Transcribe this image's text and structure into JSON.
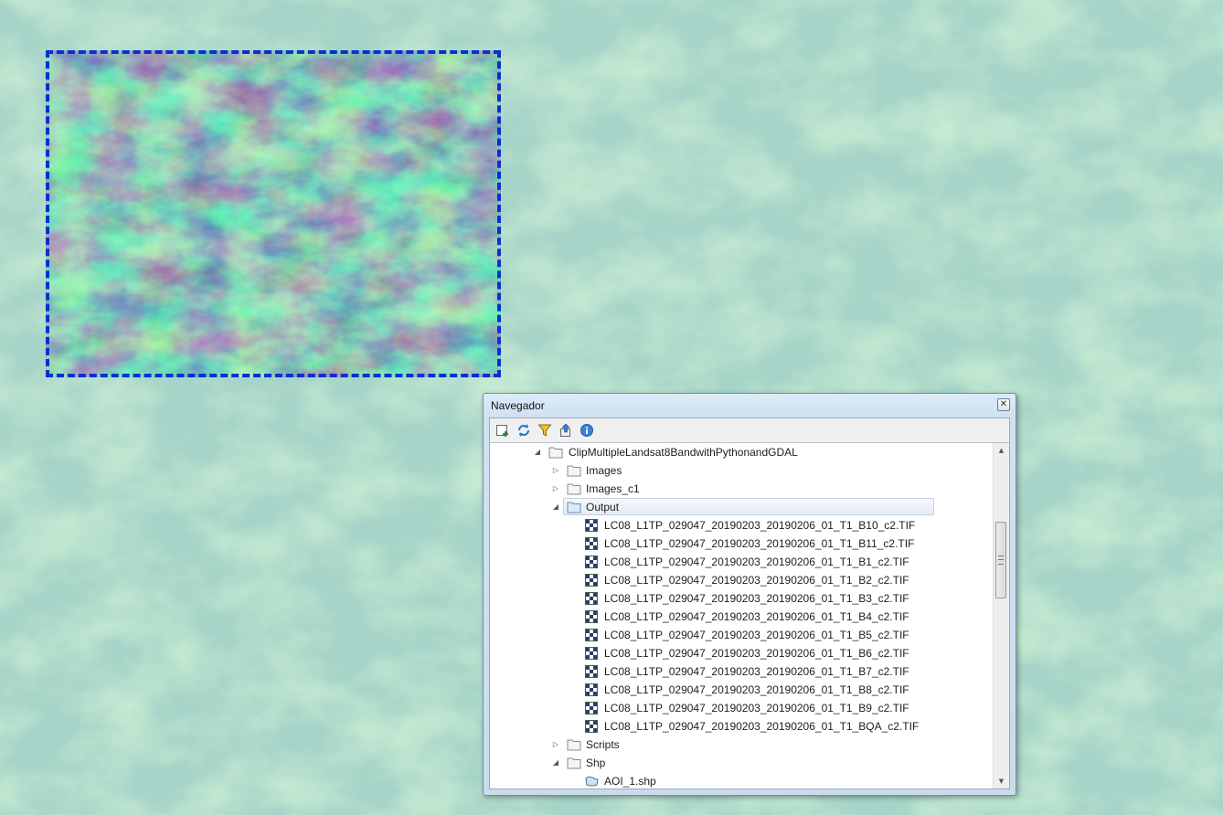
{
  "navigator": {
    "title": "Navegador",
    "close_glyph": "✕",
    "toolbar": [
      {
        "name": "add-layer-icon"
      },
      {
        "name": "refresh-icon"
      },
      {
        "name": "filter-icon"
      },
      {
        "name": "collapse-all-icon"
      },
      {
        "name": "info-icon"
      }
    ],
    "tree": {
      "root": {
        "label": "ClipMultipleLandsat8BandwithPythonandGDAL",
        "expanded": true
      },
      "folders_top": [
        {
          "label": "Images",
          "expanded": false
        },
        {
          "label": "Images_c1",
          "expanded": false
        },
        {
          "label": "Output",
          "expanded": true,
          "selected": true
        }
      ],
      "output_files": [
        "LC08_L1TP_029047_20190203_20190206_01_T1_B10_c2.TIF",
        "LC08_L1TP_029047_20190203_20190206_01_T1_B11_c2.TIF",
        "LC08_L1TP_029047_20190203_20190206_01_T1_B1_c2.TIF",
        "LC08_L1TP_029047_20190203_20190206_01_T1_B2_c2.TIF",
        "LC08_L1TP_029047_20190203_20190206_01_T1_B3_c2.TIF",
        "LC08_L1TP_029047_20190203_20190206_01_T1_B4_c2.TIF",
        "LC08_L1TP_029047_20190203_20190206_01_T1_B5_c2.TIF",
        "LC08_L1TP_029047_20190203_20190206_01_T1_B6_c2.TIF",
        "LC08_L1TP_029047_20190203_20190206_01_T1_B7_c2.TIF",
        "LC08_L1TP_029047_20190203_20190206_01_T1_B8_c2.TIF",
        "LC08_L1TP_029047_20190203_20190206_01_T1_B9_c2.TIF",
        "LC08_L1TP_029047_20190203_20190206_01_T1_BQA_c2.TIF"
      ],
      "folders_bottom": [
        {
          "label": "Scripts",
          "expanded": false
        },
        {
          "label": "Shp",
          "expanded": true
        }
      ],
      "shp_files": [
        "AOI_1.shp"
      ]
    }
  },
  "colors": {
    "map_background": "#a6d4c8",
    "aoi_border": "#0a2fd0",
    "raster_low": "#2c2c7c",
    "raster_high": "#6fe060"
  }
}
